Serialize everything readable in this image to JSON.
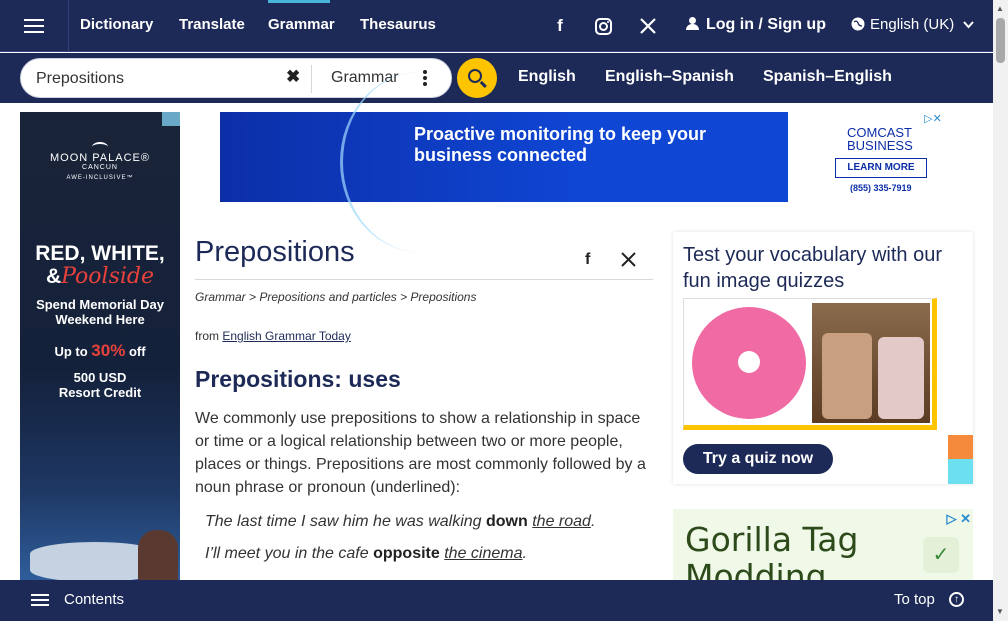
{
  "nav": {
    "links": [
      "Dictionary",
      "Translate",
      "Grammar",
      "Thesaurus"
    ],
    "active": "Grammar",
    "social": [
      "facebook-icon",
      "instagram-icon",
      "x-icon"
    ],
    "login_label": "Log in / Sign up",
    "language_label": "English (UK)"
  },
  "search": {
    "value": "Prepositions",
    "dictionary": "Grammar",
    "dict_links": [
      "English",
      "English–Spanish",
      "Spanish–English"
    ]
  },
  "left_ad": {
    "brand": "MOON PALACE®",
    "brand_sub": "CANCUN",
    "brand_tag": "AWE-INCLUSIVE™",
    "headline_1": "RED, WHITE,",
    "headline_amp": "&",
    "headline_script": "Poolside",
    "sub_1": "Spend Memorial Day",
    "sub_2": "Weekend Here",
    "offer_pre": "Up to",
    "offer_pct": "30%",
    "offer_post": "off",
    "credit_1": "500 USD",
    "credit_2": "Resort Credit"
  },
  "banner_ad": {
    "headline": "Proactive monitoring to keep your business connected",
    "brand_1": "COMCAST",
    "brand_2": "BUSINESS",
    "cta": "LEARN MORE",
    "phone": "(855) 335-7919"
  },
  "article": {
    "title": "Prepositions",
    "breadcrumb": "Grammar > Prepositions and particles > Prepositions",
    "from_label": "from",
    "source": "English Grammar Today",
    "heading": "Prepositions: uses",
    "paragraph": "We commonly use prepositions to show a relationship in space or time or a logical relationship between two or more people, places or things. Prepositions are most commonly followed by a noun phrase or pronoun (underlined):",
    "examples": [
      {
        "pre": "The last time I saw him he was walking ",
        "prep": "down",
        "mid": " ",
        "np": "the road",
        "post": "."
      },
      {
        "pre": "I’ll meet you in the cafe ",
        "prep": "opposite",
        "mid": " ",
        "np": "the cinema",
        "post": "."
      }
    ]
  },
  "quiz": {
    "title": "Test your vocabulary with our fun image quizzes",
    "button": "Try a quiz now",
    "bar_colors": [
      "#f58a3c",
      "#6ce0f0"
    ]
  },
  "side_ad": {
    "title_1": "Gorilla Tag",
    "title_2": "Modding"
  },
  "bottom": {
    "contents": "Contents",
    "to_top": "To top"
  },
  "colors": {
    "navy": "#1d2a57",
    "yellow": "#fec400",
    "accent": "#48b4d8"
  }
}
